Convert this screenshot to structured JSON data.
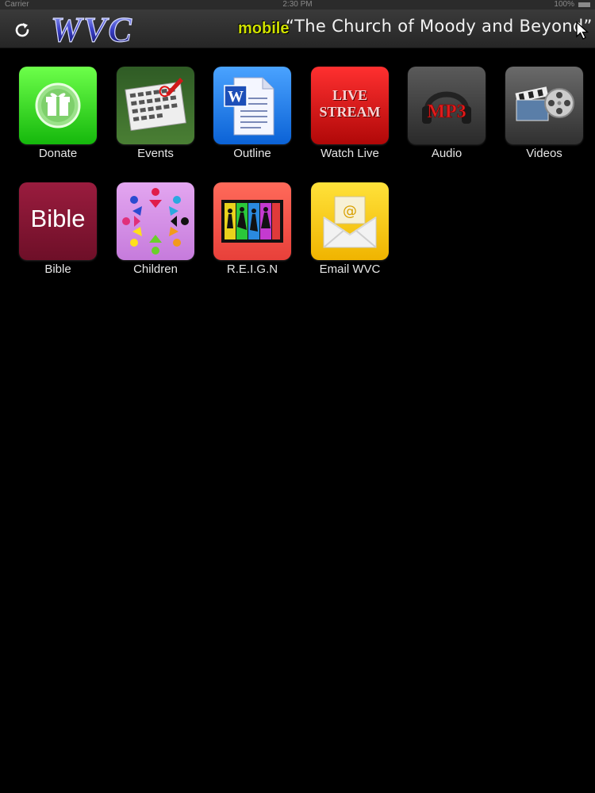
{
  "status_bar": {
    "carrier": "Carrier",
    "time": "2:30 PM",
    "battery": "100%"
  },
  "nav_bar": {
    "logo_text": "WVC",
    "logo_subtext": "mobile",
    "tagline": "“The Church of Moody and Beyond”"
  },
  "tiles": [
    {
      "label": "Donate",
      "icon": "gift-icon",
      "color": "#2ec71e"
    },
    {
      "label": "Events",
      "icon": "calendar-icon",
      "color": "#3a6a2c"
    },
    {
      "label": "Outline",
      "icon": "word-document-icon",
      "color": "#1f7fe0"
    },
    {
      "label": "Watch Live",
      "icon": "live-stream-icon",
      "color": "#d91a1a"
    },
    {
      "label": "Audio",
      "icon": "mp3-headphones-icon",
      "color": "#3c3c3c"
    },
    {
      "label": "Videos",
      "icon": "film-reel-icon",
      "color": "#4a4a4a"
    },
    {
      "label": "Bible",
      "icon": "bible-icon",
      "color": "#8c1636"
    },
    {
      "label": "Children",
      "icon": "children-circle-icon",
      "color": "#d690e6"
    },
    {
      "label": "R.E.I.G.N",
      "icon": "dancers-icon",
      "color": "#f25a4e"
    },
    {
      "label": "Email WVC",
      "icon": "email-icon",
      "color": "#f2c400"
    }
  ],
  "icon_text": {
    "bible": "Bible",
    "live_line1": "LIVE",
    "live_line2": "STREAM",
    "mp3": "MP3"
  }
}
